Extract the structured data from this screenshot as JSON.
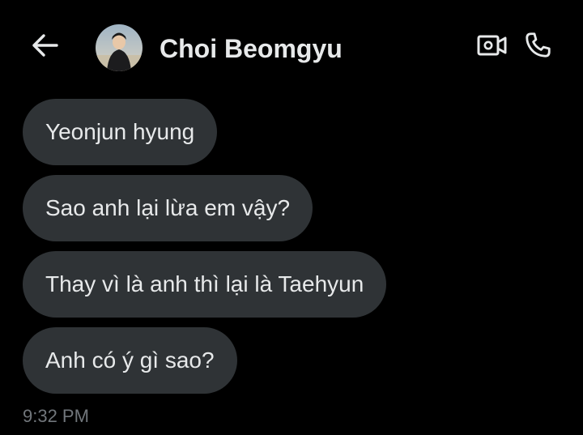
{
  "colors": {
    "background": "#000000",
    "bubble": "#2f3336",
    "text": "#e7e9ea",
    "muted": "#71767b"
  },
  "header": {
    "back_icon": "arrow-left-icon",
    "contact_name": "Choi Beomgyu",
    "video_icon": "video-camera-icon",
    "call_icon": "phone-icon"
  },
  "messages": [
    {
      "text": "Yeonjun hyung"
    },
    {
      "text": "Sao anh lại lừa em vậy?"
    },
    {
      "text": "Thay vì là anh thì lại là Taehyun"
    },
    {
      "text": "Anh có ý gì sao?"
    }
  ],
  "timestamp": "9:32 PM"
}
